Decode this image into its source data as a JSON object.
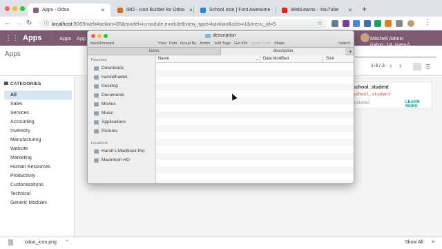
{
  "browser": {
    "tabs": [
      {
        "title": "Apps - Odoo",
        "icon_color": "#8c5f82",
        "active": true
      },
      {
        "title": "IBO - Icon Builder for Odoo",
        "icon_color": "#d2691e"
      },
      {
        "title": "School Icon | Font Awesome",
        "icon_color": "#228ae6"
      },
      {
        "title": "WebLearns - YouTube",
        "icon_color": "#e62117"
      }
    ],
    "new_tab": "+",
    "url_host": "localhost",
    "url_rest": ":8069/web#action=35&model=ir.module.module&view_type=kanban&cids=1&menu_id=5"
  },
  "odoo": {
    "brand": "Apps",
    "menu": [
      "Apps",
      "App S"
    ],
    "user": "Mitchell Admin (odoo_14_menu)",
    "breadcrumb": "Apps",
    "pager": "1-3 / 3",
    "categories_title": "CATEGORIES",
    "categories": [
      "All",
      "Sales",
      "Services",
      "Accounting",
      "Inventory",
      "Manufacturing",
      "Website",
      "Marketing",
      "Human Resources",
      "Productivity",
      "Customizations",
      "Technical",
      "Generic Modules"
    ],
    "card": {
      "name": "school_student",
      "tech": "school_student",
      "state": "Installed",
      "action": "LEARN MORE"
    }
  },
  "download": {
    "filename": "odoo_icon.png",
    "show_all": "Show All"
  },
  "finder": {
    "title": "description",
    "toolbar": {
      "nav": "Back/Forward",
      "view": "View",
      "path": "Path",
      "group_by": "Group By",
      "action": "Action",
      "edit_tags": "Edit Tags",
      "get_info": "Get Info",
      "quick_look": "Quick Look",
      "share": "Share",
      "search": "Search"
    },
    "tabs": [
      "icons",
      "description"
    ],
    "favorites_title": "Favorites",
    "favorites": [
      "Downloads",
      "harshdhaduk",
      "Desktop",
      "Documents",
      "Movies",
      "Music",
      "Applications",
      "Pictures"
    ],
    "locations_title": "Locations",
    "locations": [
      "Harsh's MacBook Pro",
      "Macintosh HD"
    ],
    "columns": {
      "name": "Name",
      "date": "Date Modified",
      "size": "Size"
    }
  }
}
